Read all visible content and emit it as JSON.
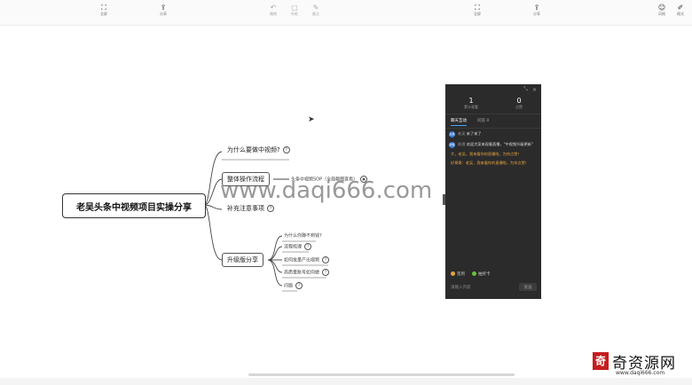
{
  "toolbar": {
    "left_group": [
      {
        "icon": "fullscreen-icon",
        "label": "全屏"
      },
      {
        "icon": "share-icon",
        "label": "分享"
      }
    ],
    "center_group": [
      {
        "icon": "undo-icon",
        "label": "撤销"
      },
      {
        "icon": "frame-icon",
        "label": "外框"
      },
      {
        "icon": "note-icon",
        "label": "备注"
      }
    ],
    "right_group": [
      {
        "icon": "fullscreen-icon",
        "label": "全屏"
      },
      {
        "icon": "share-icon",
        "label": "分享"
      }
    ],
    "far_right": [
      {
        "icon": "theme-icon",
        "label": "风格"
      },
      {
        "icon": "format-icon",
        "label": "格式"
      }
    ]
  },
  "mindmap": {
    "root": "老吴头条中视频项目实操分享",
    "branches": [
      {
        "label": "为什么要做中视频?",
        "tag": "?"
      },
      {
        "label": "整体操作流程",
        "children": [
          "头条中视频SOP（全局截图查看）"
        ]
      },
      {
        "label": "补充注意事项",
        "tag": "?"
      },
      {
        "label": "升级版分享",
        "children": [
          {
            "label": "为什么你赚不到钱?",
            "tag": ""
          },
          {
            "label": "流程梳理",
            "tag": "?"
          },
          {
            "label": "如何批量产出视频",
            "tag": "?"
          },
          {
            "label": "高质量账号如何做",
            "tag": "?"
          },
          {
            "label": "问题",
            "tag": "?"
          }
        ]
      }
    ]
  },
  "watermark": "www.daqi666.com",
  "chat": {
    "stats": [
      {
        "value": "1",
        "label": "累计观看"
      },
      {
        "value": "0",
        "label": "点赞"
      }
    ],
    "tabs": [
      "聊天互动",
      "问答 0"
    ],
    "messages": [
      {
        "avatar": "主播",
        "user": "老吴",
        "text": "来了来了"
      },
      {
        "avatar": "助理",
        "user": "助理",
        "text": "欢迎大家来观看直播，\"中视频升级更新\""
      }
    ],
    "system_notes": [
      "大，老吴，我来看你的直播啦，为你点赞！",
      "好哥哥：老吴，我来看你的直播啦，为你点赞！"
    ],
    "actions": [
      {
        "label": "签到",
        "color": "#e6a23c"
      },
      {
        "label": "抽奖卡",
        "color": "#67c23a"
      }
    ],
    "input_placeholder": "请输入内容",
    "send_label": "发送"
  },
  "brand": {
    "seal": "奇",
    "name": "奇资源网",
    "url": "www.daqi666.com"
  }
}
